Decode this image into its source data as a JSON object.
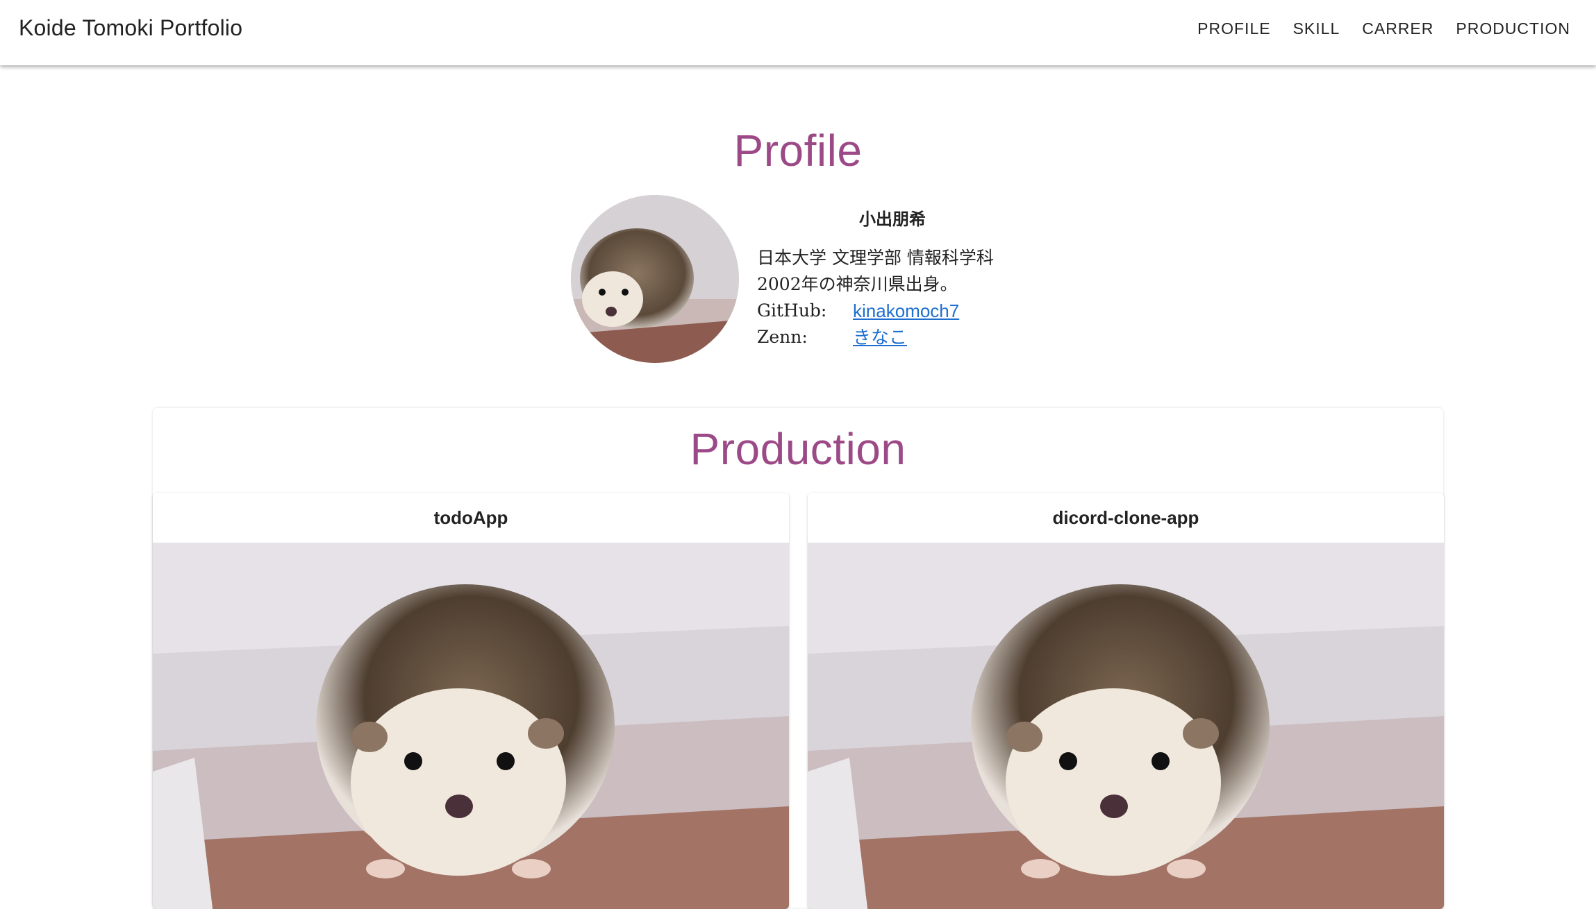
{
  "header": {
    "brand": "Koide Tomoki Portfolio",
    "nav": [
      "PROFILE",
      "SKILL",
      "CARRER",
      "PRODUCTION"
    ]
  },
  "profile": {
    "title": "Profile",
    "avatar_icon": "hedgehog-photo",
    "name": "小出朋希",
    "description_line1": "日本大学  文理学部  情報科学科",
    "description_line2": "2002年の神奈川県出身。",
    "links": [
      {
        "label": "GitHub:",
        "text": "kinakomoch7"
      },
      {
        "label": "Zenn:",
        "text": "きなこ"
      }
    ]
  },
  "production": {
    "title": "Production",
    "items": [
      {
        "title": "todoApp",
        "image": "hedgehog-photo"
      },
      {
        "title": "dicord-clone-app",
        "image": "hedgehog-photo"
      }
    ]
  },
  "colors": {
    "accent": "#9c4a87",
    "link": "#1f6fd0"
  }
}
